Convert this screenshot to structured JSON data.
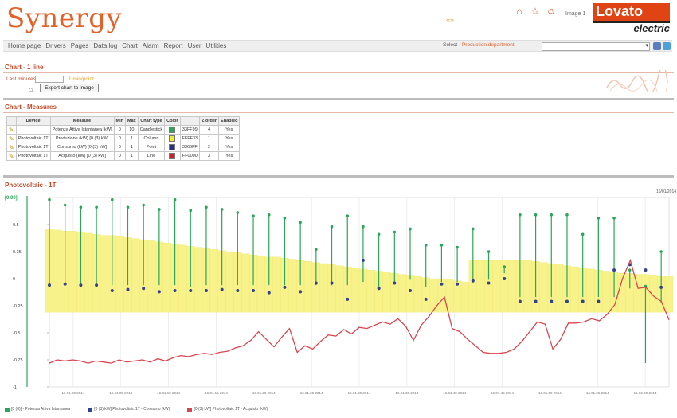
{
  "header": {
    "logo_main": "Synergy",
    "center_text": "«»",
    "icons": [
      "home-icon",
      "star-icon",
      "user-icon"
    ],
    "user_label": "Image 1",
    "brand_top": "Lovato",
    "brand_bottom": "electric"
  },
  "nav": {
    "items": [
      "Home page",
      "Drivers",
      "Pages",
      "Data log",
      "Chart",
      "Alarm",
      "Report",
      "User",
      "Utilities"
    ],
    "plant_label": "Select",
    "plant_value": "Production department",
    "select_value": ""
  },
  "chart_section": {
    "title": "Chart - 1 line",
    "last_label": "Last minutes",
    "last_unit": "1 min/point",
    "export_label": "Export chart to image"
  },
  "measures_section": {
    "title": "Chart - Measures",
    "columns": [
      "",
      "Device",
      "Measure",
      "Min",
      "Max",
      "Chart type",
      "Color",
      "",
      "Z order",
      "Enabled"
    ],
    "rows": [
      {
        "device": "",
        "measure": "Potenza Attiva Istantanea [kW]",
        "min": "0",
        "max": "10",
        "type": "Candlestick",
        "color": "#2aa65a",
        "hex": "33FF99",
        "z": "4",
        "enabled": "Yes"
      },
      {
        "device": "Photovoltaic 1T",
        "measure": "Produzione (kW) [0 (3) kW]",
        "min": "0",
        "max": "1",
        "type": "Column",
        "color": "#f0ea3a",
        "hex": "FFFF33",
        "z": "1",
        "enabled": "Yes"
      },
      {
        "device": "Photovoltaic 1T",
        "measure": "Consumo (kW) [0 (3) kW]",
        "min": "0",
        "max": "1",
        "type": "Point",
        "color": "#26347e",
        "hex": "3366FF",
        "z": "2",
        "enabled": "Yes"
      },
      {
        "device": "Photovoltaic 1T",
        "measure": "Acquisto (kW) [0 (3) kW]",
        "min": "0",
        "max": "1",
        "type": "Line",
        "color": "#d0202a",
        "hex": "FF0000",
        "z": "3",
        "enabled": "Yes"
      }
    ]
  },
  "chart_data": {
    "type": "line",
    "title": "Photovoltaic - 1T",
    "header_right": "16/01/2014",
    "ylabel": "[0.00]",
    "ylim": [
      -1,
      0.75
    ],
    "y_ticks": [
      "0.5",
      "0.25",
      "0",
      "-0.25",
      "-0.5",
      "-0.75",
      "-1"
    ],
    "x_count": 80,
    "x_tick_labels": [
      "16.01.00 2014",
      "16.01.05 2014",
      "16.01.10 2014",
      "16.01.15 2014",
      "16.01.20 2014",
      "16.01.25 2014",
      "16.01.30 2014",
      "16.01.35 2014",
      "16.01.40 2014",
      "16.01.45 2014",
      "16.01.50 2014",
      "16.01.55 2014",
      "16.02.00 2014"
    ],
    "series": [
      {
        "name": "[0 (0)] - Potenza Attiva Istantanea",
        "kind": "candlestick",
        "color": "#2aa65a",
        "points": [
          {
            "x": 0,
            "top": 0.73,
            "bottom": -0.05
          },
          {
            "x": 2,
            "top": 0.68,
            "bottom": -0.04
          },
          {
            "x": 4,
            "top": 0.66,
            "bottom": -0.04
          },
          {
            "x": 6,
            "top": 0.66,
            "bottom": -0.04
          },
          {
            "x": 8,
            "top": 0.73,
            "bottom": -0.06
          },
          {
            "x": 10,
            "top": 0.66,
            "bottom": -0.06
          },
          {
            "x": 12,
            "top": 0.68,
            "bottom": -0.06
          },
          {
            "x": 14,
            "top": 0.64,
            "bottom": -0.06
          },
          {
            "x": 16,
            "top": 0.73,
            "bottom": -0.06
          },
          {
            "x": 18,
            "top": 0.63,
            "bottom": -0.08
          },
          {
            "x": 20,
            "top": 0.66,
            "bottom": -0.06
          },
          {
            "x": 22,
            "top": 0.64,
            "bottom": -0.06
          },
          {
            "x": 24,
            "top": 0.61,
            "bottom": -0.06
          },
          {
            "x": 26,
            "top": 0.58,
            "bottom": -0.06
          },
          {
            "x": 28,
            "top": 0.59,
            "bottom": -0.06
          },
          {
            "x": 30,
            "top": 0.56,
            "bottom": -0.06
          },
          {
            "x": 32,
            "top": 0.52,
            "bottom": -0.06
          },
          {
            "x": 34,
            "top": 0.27,
            "bottom": -0.06
          },
          {
            "x": 36,
            "top": 0.48,
            "bottom": -0.06
          },
          {
            "x": 38,
            "top": 0.58,
            "bottom": -0.06
          },
          {
            "x": 40,
            "top": 0.48,
            "bottom": -0.03
          },
          {
            "x": 42,
            "top": 0.41,
            "bottom": -0.1
          },
          {
            "x": 44,
            "top": 0.43,
            "bottom": -0.03
          },
          {
            "x": 46,
            "top": 0.46,
            "bottom": -0.01
          },
          {
            "x": 48,
            "top": 0.31,
            "bottom": -0.08
          },
          {
            "x": 50,
            "top": 0.31,
            "bottom": -0.03
          },
          {
            "x": 52,
            "top": 0.29,
            "bottom": -0.03
          },
          {
            "x": 54,
            "top": 0.46,
            "bottom": 0.0
          },
          {
            "x": 56,
            "top": 0.25,
            "bottom": -0.01
          },
          {
            "x": 58,
            "top": 0.11,
            "bottom": 0.05
          },
          {
            "x": 60,
            "top": 0.59,
            "bottom": -0.17
          },
          {
            "x": 62,
            "top": 0.59,
            "bottom": -0.17
          },
          {
            "x": 64,
            "top": 0.59,
            "bottom": -0.17
          },
          {
            "x": 66,
            "top": 0.59,
            "bottom": -0.17
          },
          {
            "x": 68,
            "top": 0.41,
            "bottom": -0.17
          },
          {
            "x": 70,
            "top": 0.56,
            "bottom": -0.17
          },
          {
            "x": 72,
            "top": 0.56,
            "bottom": -0.17
          },
          {
            "x": 74,
            "top": 0.08,
            "bottom": -0.09
          },
          {
            "x": 76,
            "top": -0.07,
            "bottom": -0.78
          },
          {
            "x": 78,
            "top": 0.25,
            "bottom": -0.22
          }
        ]
      },
      {
        "name": "Photovoltaic 1T - Produzione (kW)",
        "kind": "column",
        "color": "#f7f28a",
        "values": [
          0.46,
          0.45,
          0.44,
          0.44,
          0.43,
          0.42,
          0.41,
          0.4,
          0.4,
          0.39,
          0.38,
          0.37,
          0.36,
          0.35,
          0.34,
          0.33,
          0.32,
          0.31,
          0.3,
          0.29,
          0.28,
          0.27,
          0.26,
          0.25,
          0.24,
          0.23,
          0.22,
          0.21,
          0.2,
          0.2,
          0.19,
          0.18,
          0.17,
          0.16,
          0.15,
          0.14,
          0.13,
          0.12,
          0.11,
          0.1,
          0.09,
          0.08,
          0.07,
          0.06,
          0.05,
          0.04,
          0.03,
          0.02,
          0.01,
          0.0,
          0.0,
          -0.01,
          -0.02,
          -0.03,
          0.17,
          0.17,
          0.17,
          0.17,
          0.17,
          0.17,
          0.17,
          0.17,
          0.16,
          0.15,
          0.14,
          0.13,
          0.12,
          0.11,
          0.1,
          0.09,
          0.08,
          0.07,
          0.06,
          0.05,
          0.05,
          0.04,
          0.04,
          0.03,
          0.02,
          0.02
        ],
        "base": -0.31
      },
      {
        "name": "[0 (3) kW] Photovoltaic 1T - Consumo (kW)",
        "kind": "point",
        "color": "#33418f",
        "points": [
          [
            0,
            -0.06
          ],
          [
            2,
            -0.05
          ],
          [
            4,
            -0.06
          ],
          [
            6,
            -0.06
          ],
          [
            8,
            -0.11
          ],
          [
            10,
            -0.1
          ],
          [
            12,
            -0.09
          ],
          [
            14,
            -0.12
          ],
          [
            16,
            -0.11
          ],
          [
            18,
            -0.11
          ],
          [
            20,
            -0.11
          ],
          [
            22,
            -0.1
          ],
          [
            24,
            -0.11
          ],
          [
            26,
            -0.11
          ],
          [
            28,
            -0.13
          ],
          [
            30,
            -0.08
          ],
          [
            32,
            -0.12
          ],
          [
            34,
            -0.04
          ],
          [
            36,
            -0.04
          ],
          [
            38,
            -0.19
          ],
          [
            40,
            0.17
          ],
          [
            42,
            -0.09
          ],
          [
            44,
            -0.04
          ],
          [
            46,
            -0.11
          ],
          [
            48,
            -0.19
          ],
          [
            50,
            -0.05
          ],
          [
            52,
            -0.05
          ],
          [
            54,
            -0.02
          ],
          [
            56,
            -0.04
          ],
          [
            58,
            0.0
          ],
          [
            60,
            -0.21
          ],
          [
            62,
            -0.21
          ],
          [
            64,
            -0.21
          ],
          [
            66,
            -0.21
          ],
          [
            68,
            -0.21
          ],
          [
            70,
            -0.21
          ],
          [
            72,
            0.08
          ],
          [
            74,
            0.13
          ],
          [
            76,
            0.08
          ],
          [
            78,
            -0.08
          ]
        ]
      },
      {
        "name": "[0 (3) kW] Photovoltaic 1T - Acquisto (kW)",
        "kind": "line",
        "color": "#d8454f",
        "values": [
          -0.78,
          -0.75,
          -0.76,
          -0.75,
          -0.76,
          -0.78,
          -0.76,
          -0.77,
          -0.78,
          -0.75,
          -0.77,
          -0.76,
          -0.75,
          -0.77,
          -0.74,
          -0.76,
          -0.73,
          -0.71,
          -0.72,
          -0.7,
          -0.69,
          -0.7,
          -0.68,
          -0.67,
          -0.64,
          -0.62,
          -0.57,
          -0.49,
          -0.56,
          -0.63,
          -0.54,
          -0.46,
          -0.68,
          -0.62,
          -0.65,
          -0.58,
          -0.52,
          -0.53,
          -0.47,
          -0.51,
          -0.45,
          -0.46,
          -0.43,
          -0.4,
          -0.42,
          -0.37,
          -0.44,
          -0.57,
          -0.43,
          -0.35,
          -0.25,
          -0.17,
          -0.46,
          -0.49,
          -0.56,
          -0.62,
          -0.68,
          -0.69,
          -0.69,
          -0.68,
          -0.65,
          -0.58,
          -0.49,
          -0.4,
          -0.42,
          -0.65,
          -0.56,
          -0.41,
          -0.41,
          -0.4,
          -0.37,
          -0.39,
          -0.33,
          -0.24,
          0.0,
          0.17,
          -0.09,
          -0.08,
          -0.16,
          -0.21,
          -0.38
        ],
        "markers": []
      }
    ],
    "legend_placement": "bottom-left",
    "legend_entries": [
      "[0 (0)] - Potenza Attiva Istantanea",
      "[0 (3) kW] Photovoltaic 1T - Consumo (kW)",
      "[0 (3) kW] Photovoltaic 1T - Acquisto (kW)"
    ],
    "grid": true
  }
}
